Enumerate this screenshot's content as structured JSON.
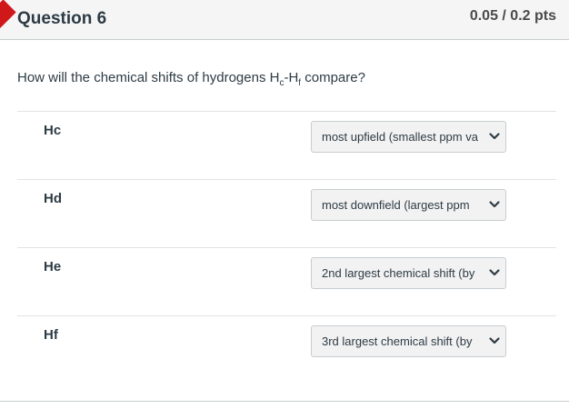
{
  "question": {
    "title": "Question 6",
    "points": "0.05 / 0.2 pts",
    "text_prefix": "How will the chemical shifts of hydrogens H",
    "sub1": "c",
    "mid": "-H",
    "sub2": "f",
    "text_suffix": " compare?"
  },
  "rows": [
    {
      "label": "Hc",
      "selected": "most upfield (smallest ppm va"
    },
    {
      "label": "Hd",
      "selected": "most downfield (largest ppm "
    },
    {
      "label": "He",
      "selected": "2nd largest chemical shift (by"
    },
    {
      "label": "Hf",
      "selected": "3rd largest chemical shift (by"
    }
  ],
  "colors": {
    "flag": "#d0181a",
    "header_bg": "#f5f5f5",
    "select_bg": "#f2f2f2"
  },
  "icons": {
    "flag": "flag-icon",
    "dropdown": "chevron-down-icon"
  }
}
